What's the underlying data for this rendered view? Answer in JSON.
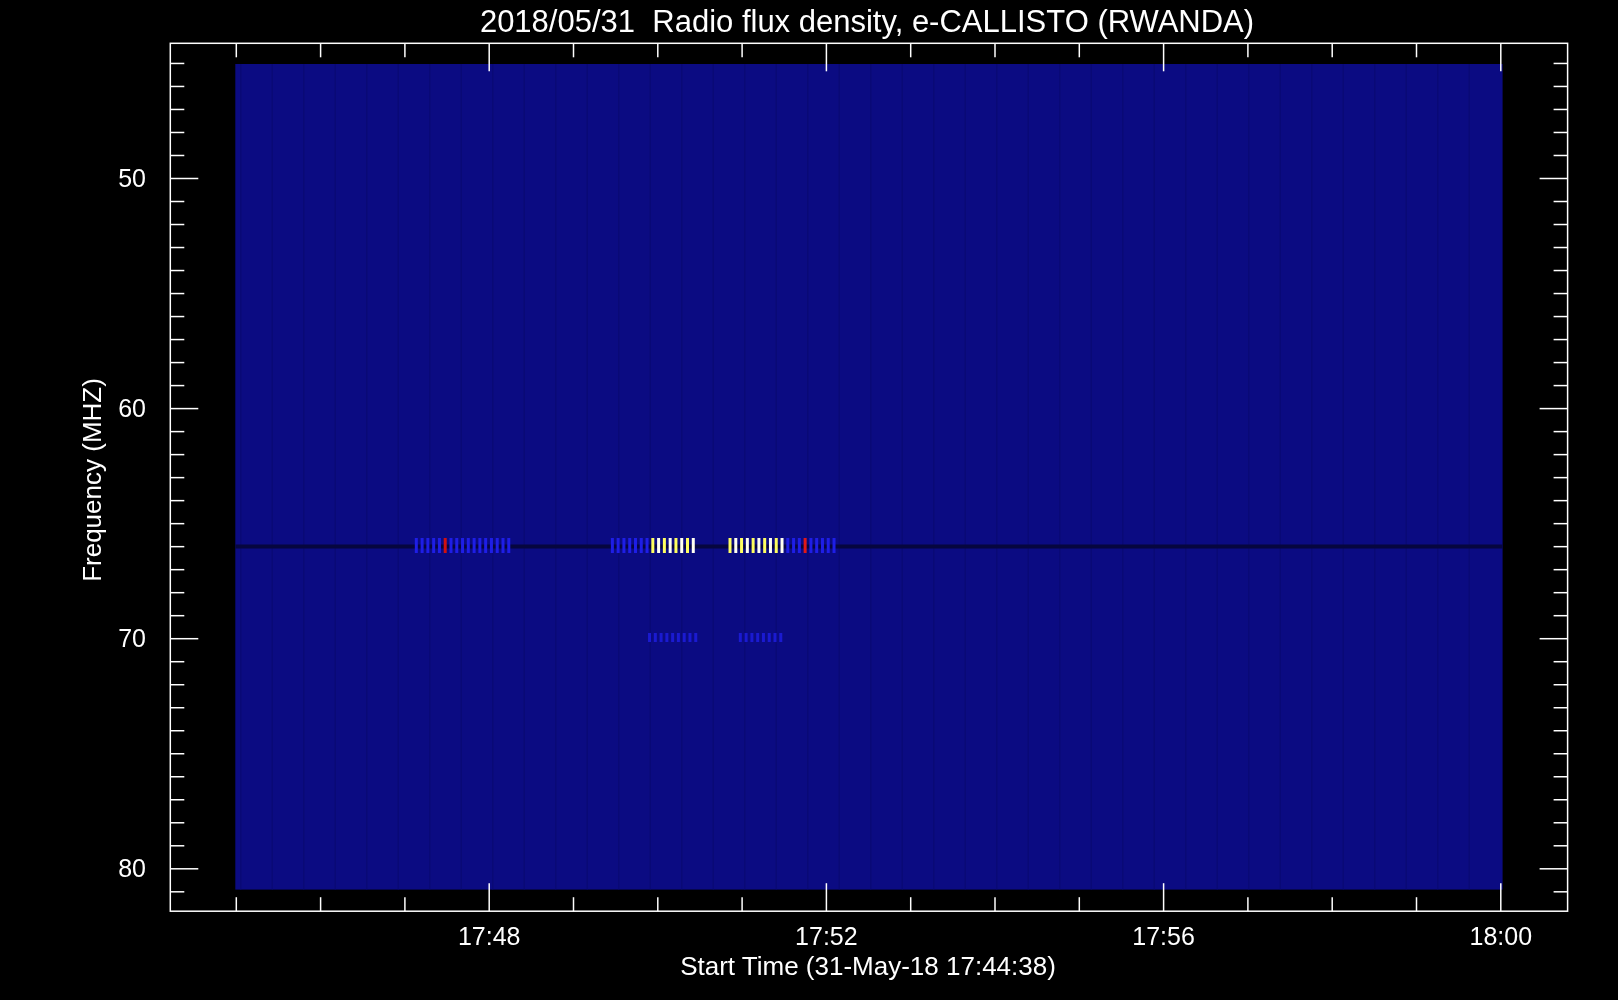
{
  "chart": {
    "title": "2018/05/31  Radio flux density, e-CALLISTO (RWANDA)",
    "xlabel": "Start Time (31-May-18 17:44:38)",
    "ylabel": "Frequency (MHZ)",
    "x_tick_labels": [
      "17:48",
      "17:52",
      "17:56",
      "18:00"
    ],
    "y_tick_labels": [
      "50",
      "60",
      "70",
      "80"
    ]
  }
}
